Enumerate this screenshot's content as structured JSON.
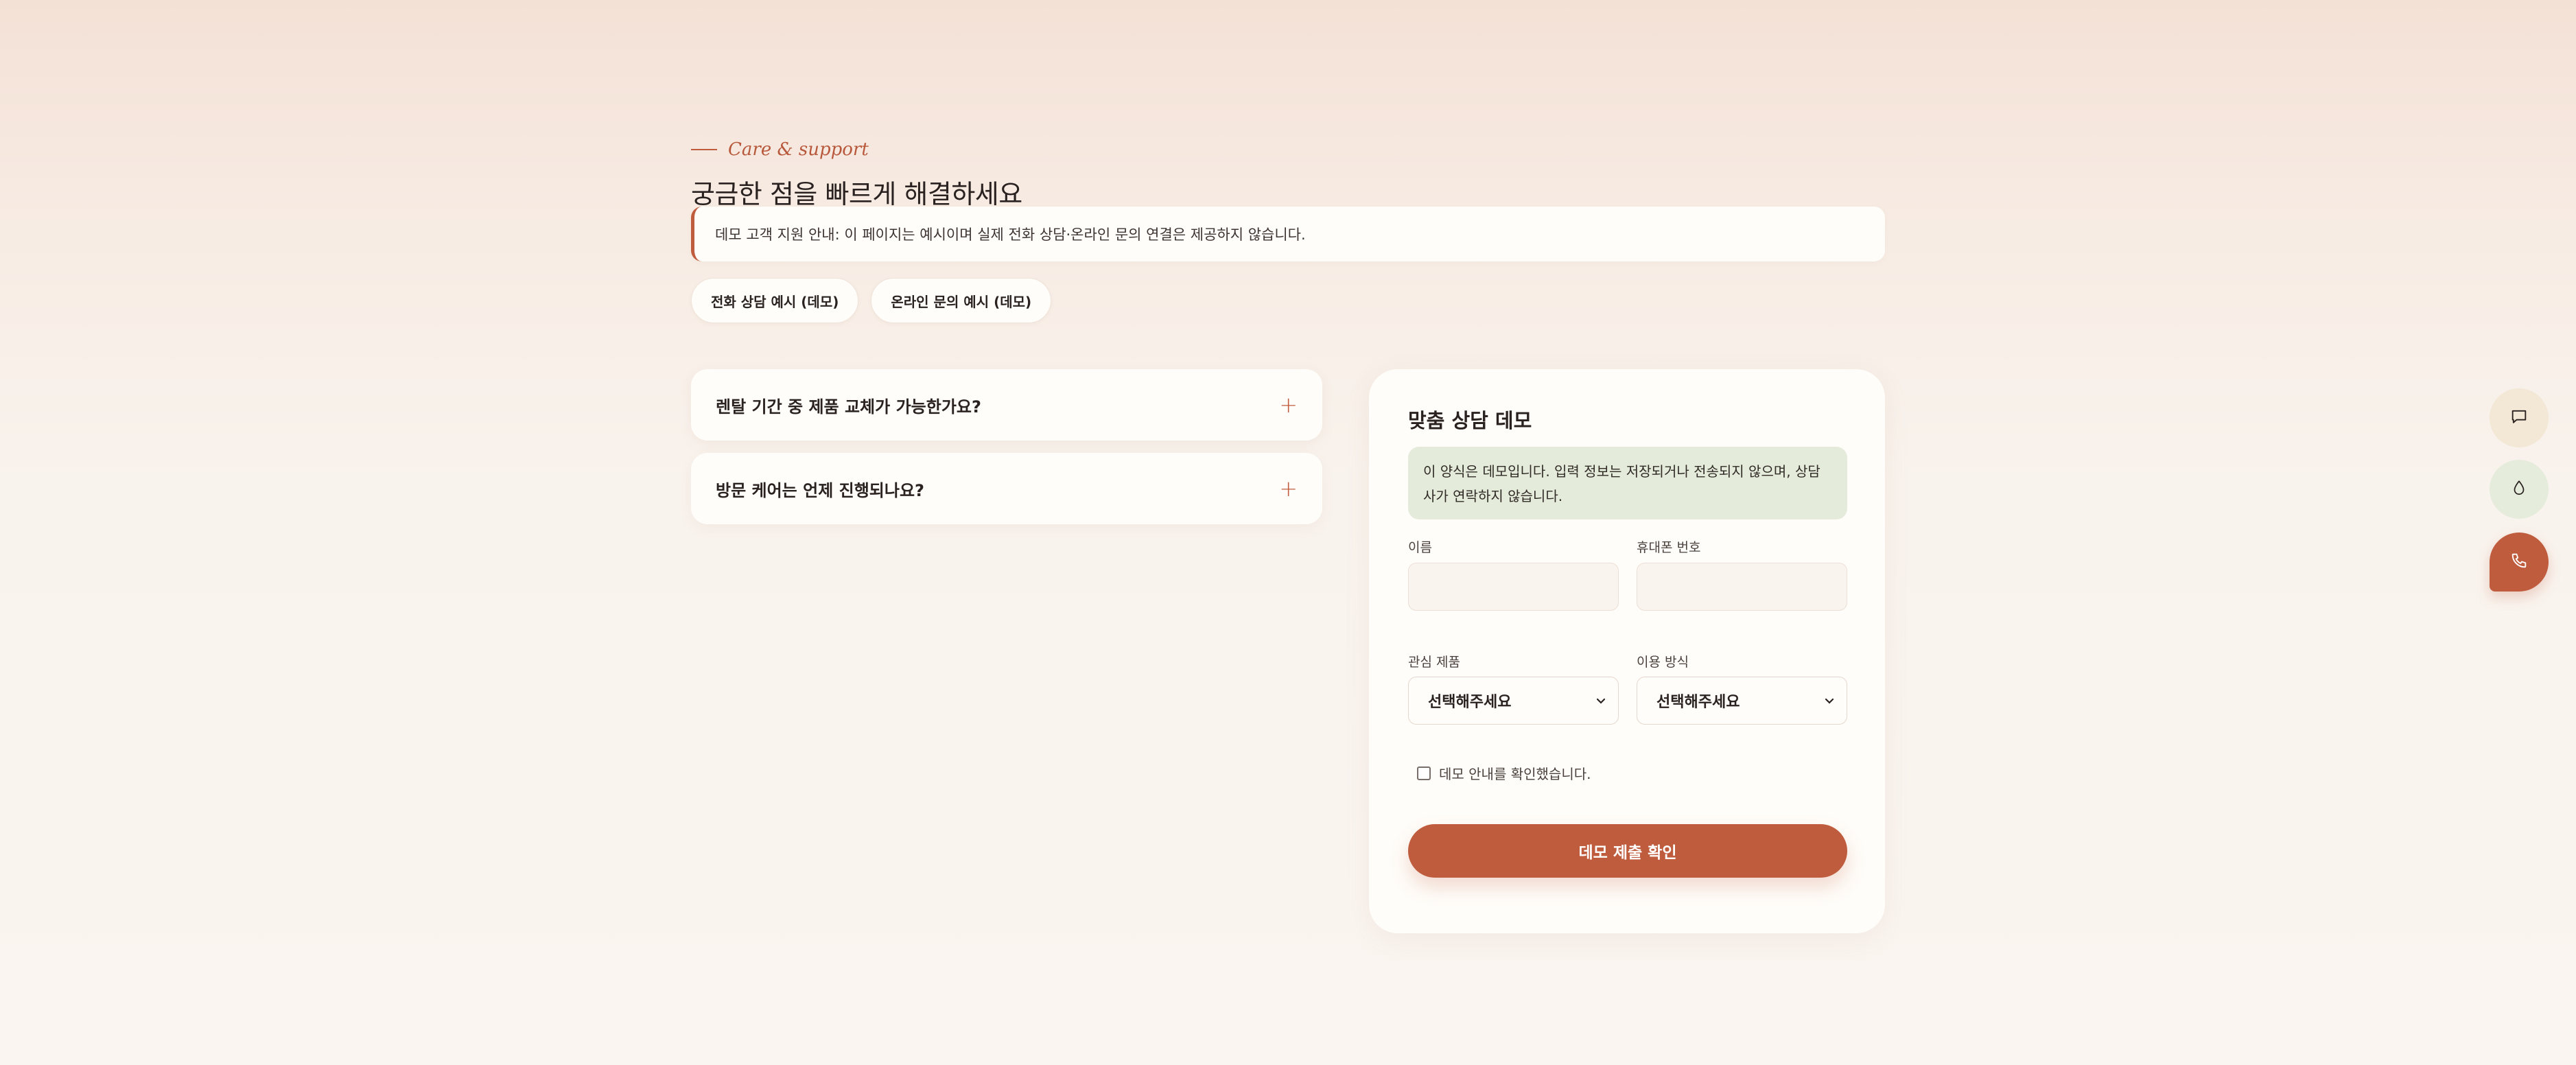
{
  "header": {
    "eyebrow": "Care & support",
    "title": "궁금한 점을 빠르게 해결하세요",
    "notice": "데모 고객 지원 안내: 이 페이지는 예시이며 실제 전화 상담·온라인 문의 연결은 제공하지 않습니다."
  },
  "chips": [
    {
      "label": "전화 상담 예시 (데모)"
    },
    {
      "label": "온라인 문의 예시 (데모)"
    }
  ],
  "faq": [
    {
      "question": "렌탈 기간 중 제품 교체가 가능한가요?",
      "toggle": "+"
    },
    {
      "question": "방문 케어는 언제 진행되나요?",
      "toggle": "+"
    }
  ],
  "form": {
    "title": "맞춤 상담 데모",
    "notice": "이 양식은 데모입니다. 입력 정보는 저장되거나 전송되지 않으며, 상담사가 연락하지 않습니다.",
    "name_label": "이름",
    "phone_label": "휴대폰 번호",
    "product_label": "관심 제품",
    "product_value": "선택해주세요",
    "method_label": "이용 방식",
    "method_value": "선택해주세요",
    "confirm_label": "데모 안내를 확인했습니다.",
    "submit_label": "데모 제출 확인"
  },
  "floating_actions": [
    {
      "icon": "chat-icon"
    },
    {
      "icon": "water-drop-icon"
    },
    {
      "icon": "phone-icon"
    }
  ],
  "colors": {
    "accent": "#c05c3e",
    "card": "#fffdf9",
    "notice_green": "#e5ebdb"
  }
}
